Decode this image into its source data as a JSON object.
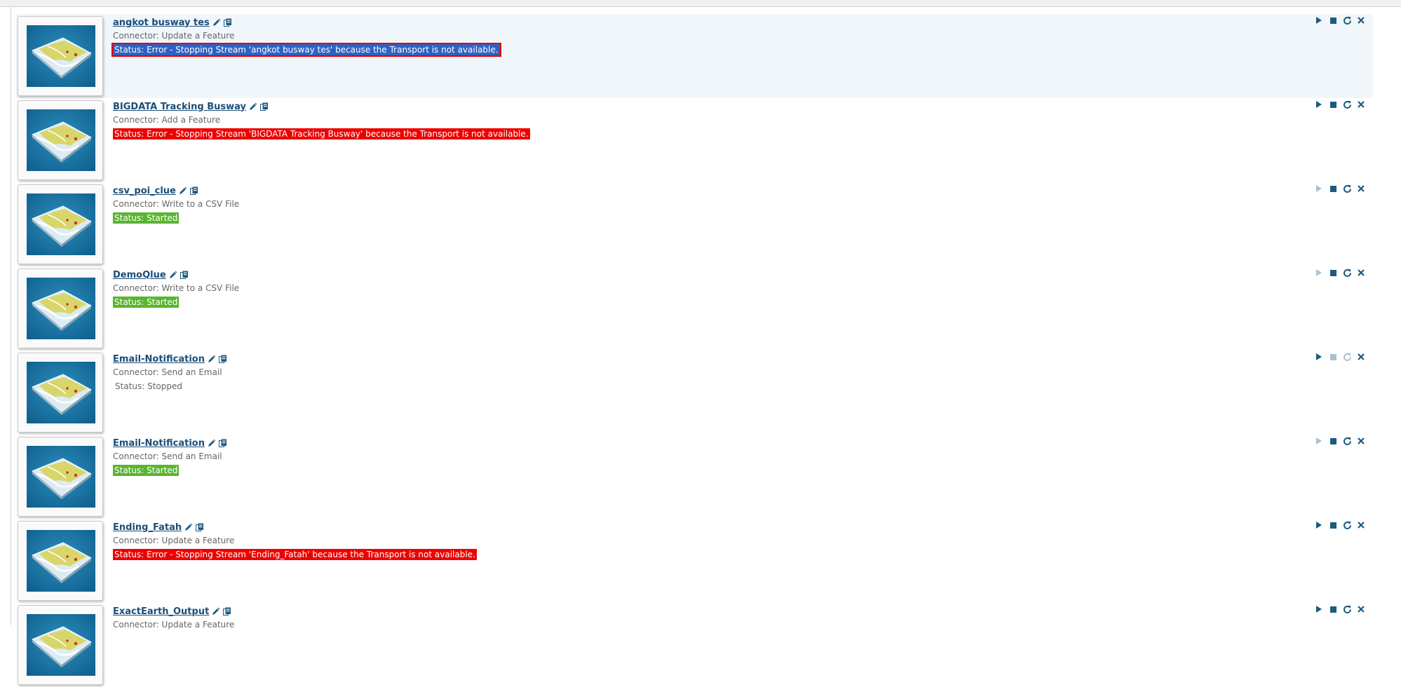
{
  "colors": {
    "title": "#1b4e78",
    "error": "#ef0000",
    "started": "#59b530",
    "icon_active": "#1d5a80",
    "icon_disabled": "#a9c2d3",
    "selected_row": "#f1f6fb"
  },
  "streams": [
    {
      "name": "angkot busway tes",
      "connector": "Connector: Update a Feature",
      "status": "Status: Error - Stopping Stream 'angkot busway tes' because the Transport is not available.",
      "status_type": "error",
      "selected": true,
      "thumbnail_icon": "feature-map-icon",
      "actions": {
        "start": "enabled",
        "stop": "enabled",
        "refresh": "enabled",
        "delete": "enabled"
      }
    },
    {
      "name": "BIGDATA Tracking Busway",
      "connector": "Connector: Add a Feature",
      "status": "Status: Error - Stopping Stream 'BIGDATA Tracking Busway' because the Transport is not available.",
      "status_type": "error",
      "selected": false,
      "thumbnail_icon": "feature-map-icon",
      "actions": {
        "start": "enabled",
        "stop": "enabled",
        "refresh": "enabled",
        "delete": "enabled"
      }
    },
    {
      "name": "csv_poi_clue",
      "connector": "Connector: Write to a CSV File",
      "status": "Status: Started",
      "status_type": "started",
      "selected": false,
      "thumbnail_icon": "feature-map-icon",
      "actions": {
        "start": "disabled",
        "stop": "enabled",
        "refresh": "enabled",
        "delete": "enabled"
      }
    },
    {
      "name": "DemoQlue",
      "connector": "Connector: Write to a CSV File",
      "status": "Status: Started",
      "status_type": "started",
      "selected": false,
      "thumbnail_icon": "feature-map-icon",
      "actions": {
        "start": "disabled",
        "stop": "enabled",
        "refresh": "enabled",
        "delete": "enabled"
      }
    },
    {
      "name": "Email-Notification",
      "connector": "Connector: Send an Email",
      "status": "Status: Stopped",
      "status_type": "stopped",
      "selected": false,
      "thumbnail_icon": "feature-map-icon",
      "actions": {
        "start": "enabled",
        "stop": "disabled",
        "refresh": "disabled",
        "delete": "enabled"
      }
    },
    {
      "name": "Email-Notification",
      "connector": "Connector: Send an Email",
      "status": "Status: Started",
      "status_type": "started",
      "selected": false,
      "thumbnail_icon": "feature-map-icon",
      "actions": {
        "start": "disabled",
        "stop": "enabled",
        "refresh": "enabled",
        "delete": "enabled"
      }
    },
    {
      "name": "Ending_Fatah",
      "connector": "Connector: Update a Feature",
      "status": "Status: Error - Stopping Stream 'Ending_Fatah' because the Transport is not available.",
      "status_type": "error",
      "selected": false,
      "thumbnail_icon": "feature-map-icon",
      "actions": {
        "start": "enabled",
        "stop": "enabled",
        "refresh": "enabled",
        "delete": "enabled"
      }
    },
    {
      "name": "ExactEarth_Output",
      "connector": "Connector: Update a Feature",
      "status": "",
      "status_type": "none",
      "selected": false,
      "thumbnail_icon": "feature-map-icon",
      "actions": {
        "start": "enabled",
        "stop": "enabled",
        "refresh": "enabled",
        "delete": "enabled"
      }
    }
  ]
}
